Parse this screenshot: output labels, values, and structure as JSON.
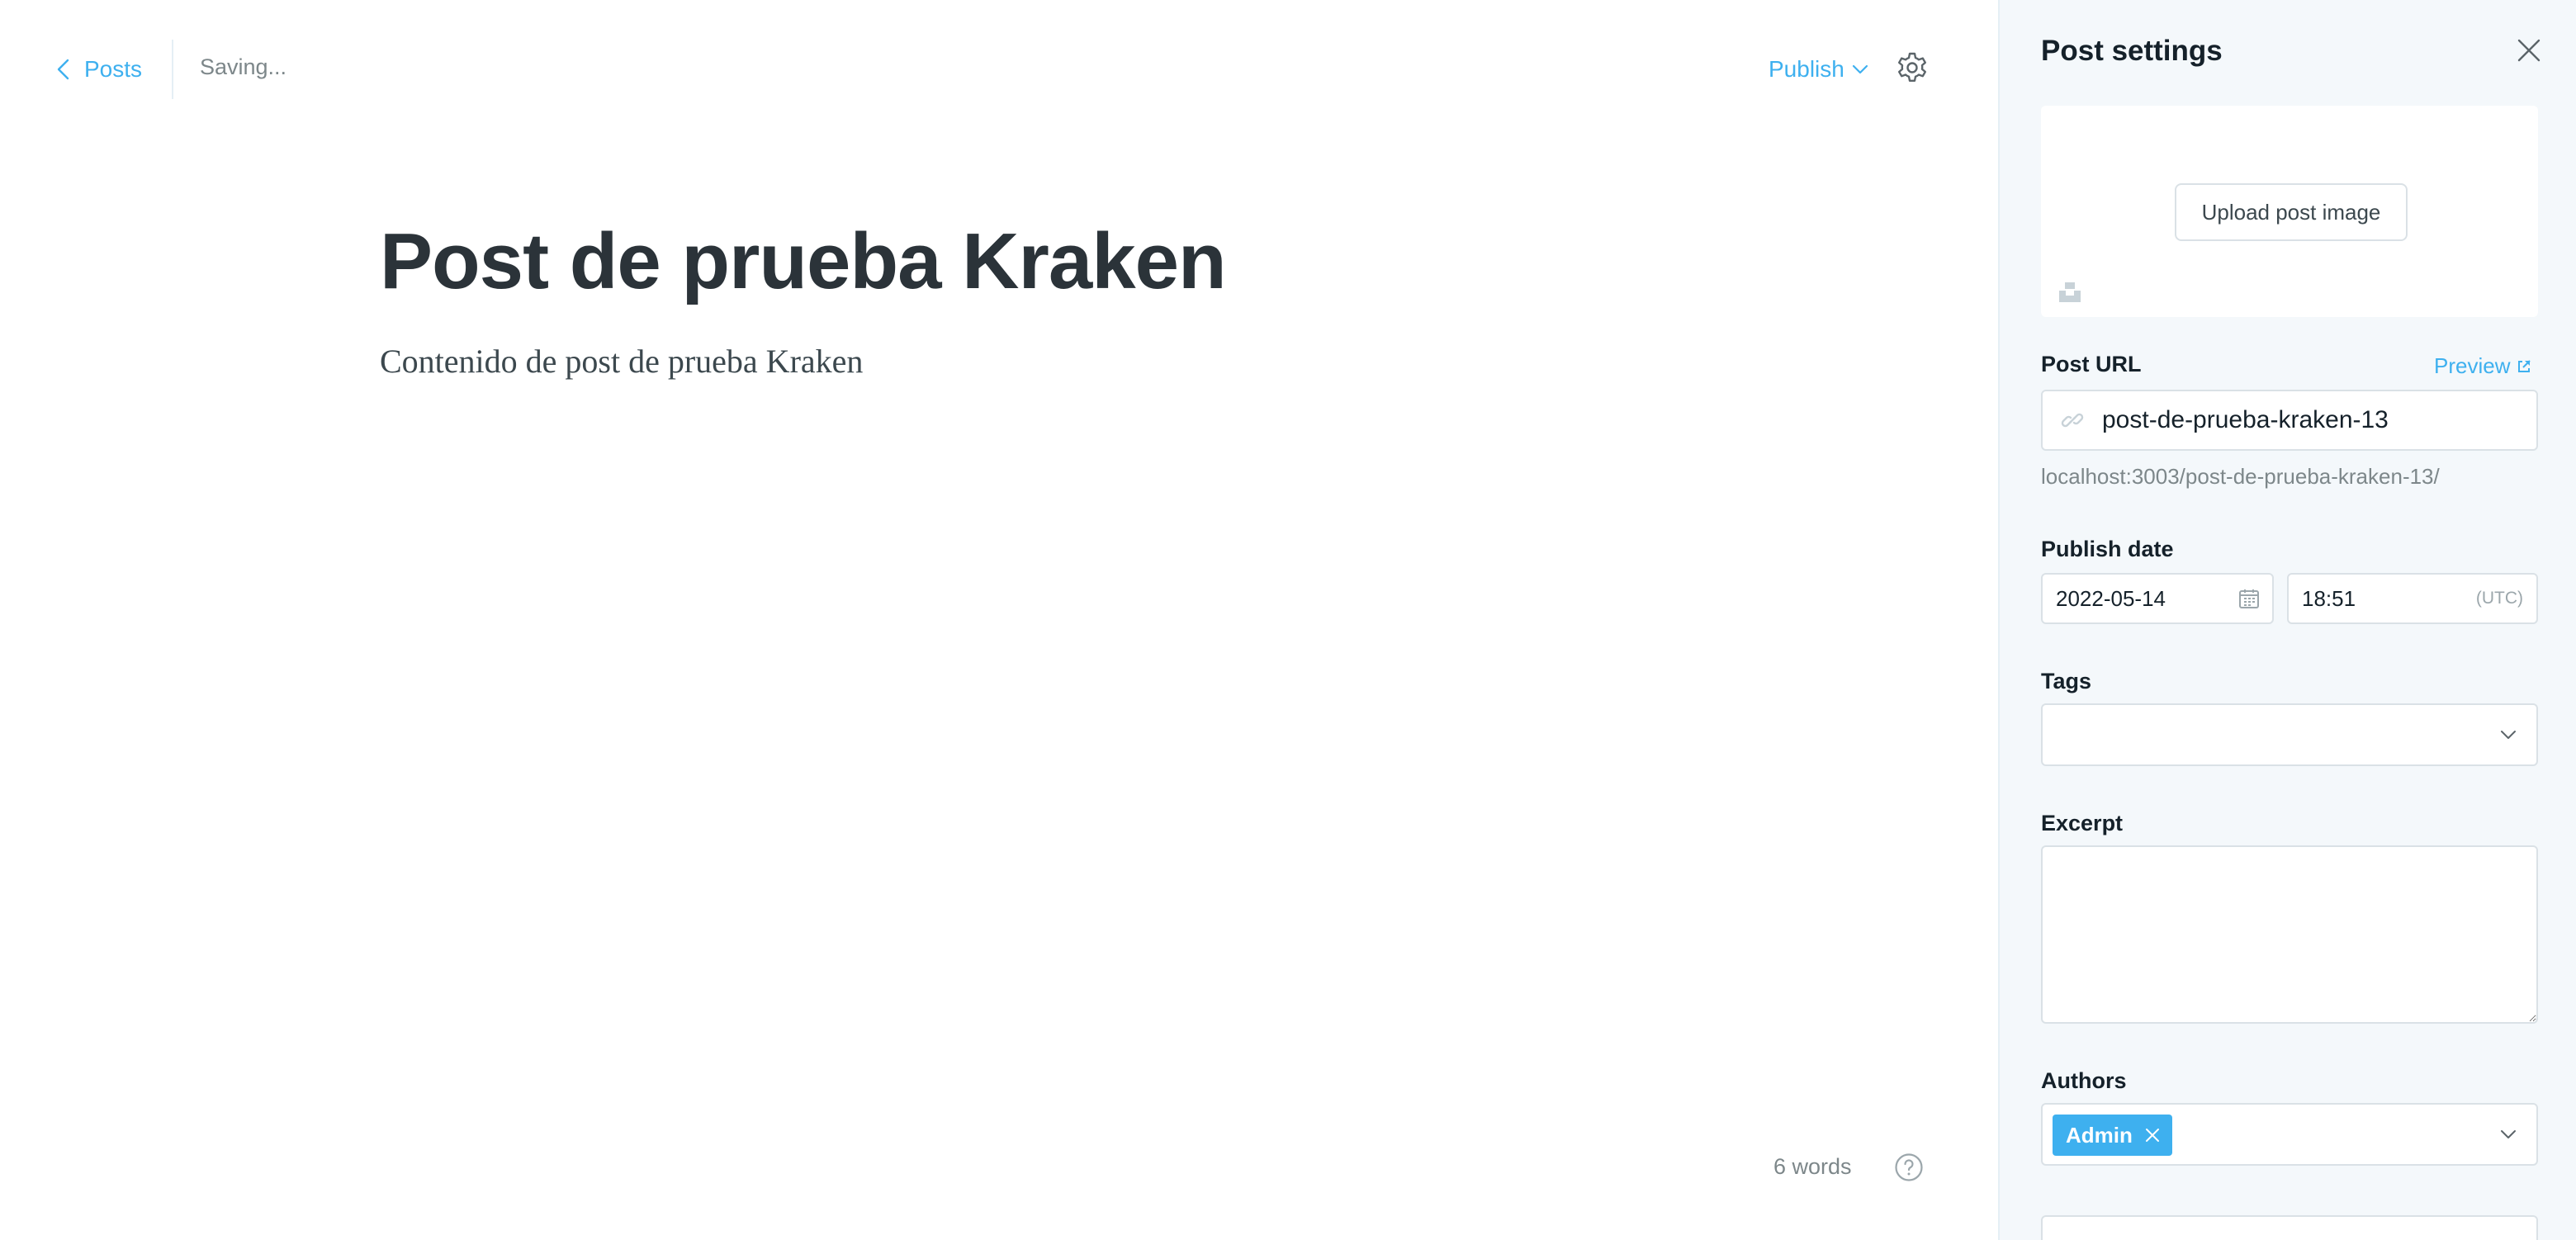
{
  "topbar": {
    "back_label": "Posts",
    "save_status": "Saving...",
    "publish_label": "Publish",
    "settings_icon": "gear-icon"
  },
  "post": {
    "title": "Post de prueba Kraken",
    "body": "Contenido de post de prueba Kraken"
  },
  "footer": {
    "word_count": "6 words",
    "help_icon": "question-circle-icon"
  },
  "settings": {
    "title": "Post settings",
    "upload_label": "Upload post image",
    "url_label": "Post URL",
    "preview_label": "Preview",
    "slug": "post-de-prueba-kraken-13",
    "full_url": "localhost:3003/post-de-prueba-kraken-13/",
    "publish_date_label": "Publish date",
    "date": "2022-05-14",
    "time": "18:51",
    "timezone": "(UTC)",
    "tags_label": "Tags",
    "excerpt_label": "Excerpt",
    "authors_label": "Authors",
    "authors": [
      "Admin"
    ]
  },
  "colors": {
    "accent": "#3eb0ef",
    "panel_bg": "#f4f8fb",
    "title_text": "#2b3339",
    "muted_text": "#7d878a",
    "border": "#dae1e6"
  }
}
